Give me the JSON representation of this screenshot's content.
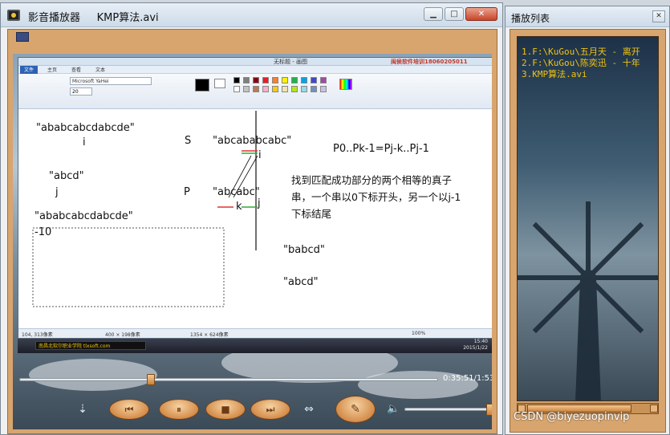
{
  "player": {
    "title": "影音播放器     KMP算法.avi",
    "minimize_glyph": "▁",
    "maximize_glyph": "□",
    "close_glyph": "✕",
    "time": "0:35:51/1:53:",
    "controls": {
      "open_glyph": "⇣",
      "prev_glyph": "⏮",
      "pause_glyph": "⏸",
      "stop_glyph": "■",
      "next_glyph": "⏭",
      "fullscreen_glyph": "⇔",
      "playlist_glyph": "✎",
      "volume_glyph": "🔈"
    },
    "progress_fraction": 0.31,
    "volume_fraction": 0.97
  },
  "video_frame": {
    "paint_title": "无标题 - 画图",
    "banner": "闽侯软件培训18060205011",
    "tabs": [
      "文件",
      "主页",
      "查看",
      "文本"
    ],
    "font_name": "Microsoft YaHei",
    "font_size": "20",
    "canvas_text": {
      "s_string": "\"ababcabcdabcde\"",
      "i_label": "i",
      "s_label": "S",
      "s_compare": "\"abcababcabc\"",
      "i_label2": "i",
      "formula": "P0..Pk-1=Pj-k..Pj-1",
      "p_string": "\"abcd\"",
      "j_label": "j",
      "p_label": "P",
      "p_compare": "\"abcabc\"",
      "k_label": "k",
      "j_label2": "j",
      "note": "找到匹配成功部分的两个相等的真子串，一个串以0下标开头，另一个以j-1下标结尾",
      "s_string2": "\"ababcabcdabcde\"",
      "neg_ten": "-10",
      "babcd": "\"babcd\"",
      "abcd2": "\"abcd\""
    },
    "status": {
      "cursor": "104, 313像素",
      "selection": "400 × 198像素",
      "canvas_size": "1354 × 624像素",
      "zoom": "100%"
    },
    "taskbar_tip": "南昌北软尔职业学院 tlxsoft.com",
    "clock_time": "15:40",
    "clock_date": "2015/1/22"
  },
  "playlist": {
    "title": "播放列表",
    "close_glyph": "✕",
    "items": [
      "1.F:\\KuGou\\五月天 - 离开",
      "2.F:\\KuGou\\陈奕迅 - 十年",
      "3.KMP算法.avi"
    ]
  },
  "watermark": "CSDN @biyezuopinvip",
  "colors": {
    "frame_brown": "#d8a56e",
    "playlist_text": "#f1c40f",
    "button_orange": "#d48d4b"
  }
}
